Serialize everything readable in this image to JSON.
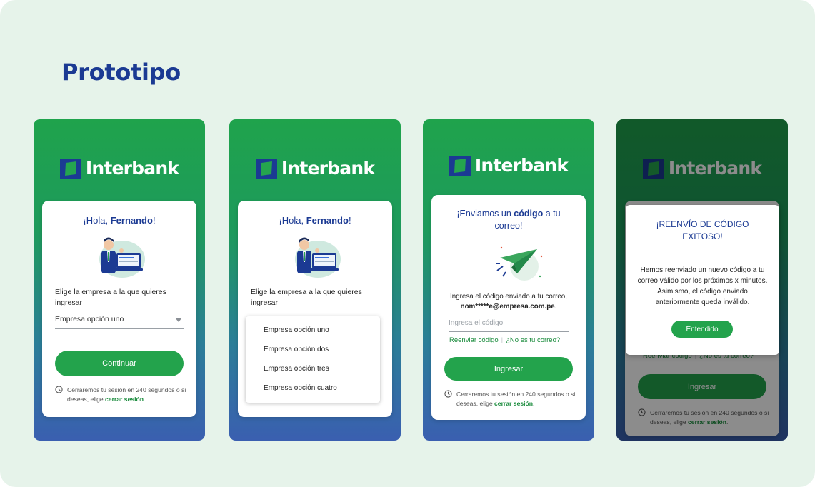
{
  "page_title": "Prototipo",
  "brand": {
    "name": "Interbank",
    "green": "#23a34c",
    "blue": "#1b3a93"
  },
  "screen1": {
    "greeting_prefix": "¡Hola, ",
    "greeting_name": "Fernando",
    "greeting_suffix": "!",
    "choose_label": "Elige la empresa a la que quieres ingresar",
    "select_value": "Empresa opción uno",
    "continue_button": "Continuar",
    "timer_text": "Cerraremos tu sesión en 240 segundos o si deseas, elige ",
    "timer_link": "cerrar sesión",
    "timer_end": "."
  },
  "screen2": {
    "greeting_prefix": "¡Hola, ",
    "greeting_name": "Fernando",
    "greeting_suffix": "!",
    "choose_label": "Elige la empresa a la que quieres ingresar",
    "options": [
      "Empresa opción uno",
      "Empresa opción dos",
      "Empresa opción tres",
      "Empresa opción cuatro"
    ]
  },
  "screen3": {
    "title_a": "¡Enviamos un ",
    "title_b": "código",
    "title_c": " a tu correo!",
    "instruction": "Ingresa el código enviado a tu correo,",
    "email": "nom*****e@empresa.com.pe",
    "email_end": ".",
    "code_placeholder": "Ingresa el código",
    "resend_link": "Reenviar código",
    "not_your_email_link": "¿No es tu correo?",
    "submit_button": "Ingresar",
    "timer_text": "Cerraremos tu sesión en 240 segundos o si deseas, elige ",
    "timer_link": "cerrar sesión",
    "timer_end": "."
  },
  "screen4": {
    "modal_title": "¡REENVÍO DE CÓDIGO EXITOSO!",
    "modal_body": "Hemos reenviado un nuevo código a tu correo válido por los próximos x minutos. Asimismo, el código enviado anteriormente queda inválido.",
    "modal_button": "Entendido",
    "resend_link": "Reenviar código",
    "not_your_email_link": "¿No es tu correo?",
    "submit_button": "Ingresar",
    "timer_text": "Cerraremos tu sesión en 240 segundos o si deseas, elige ",
    "timer_link": "cerrar sesión",
    "timer_end": "."
  }
}
